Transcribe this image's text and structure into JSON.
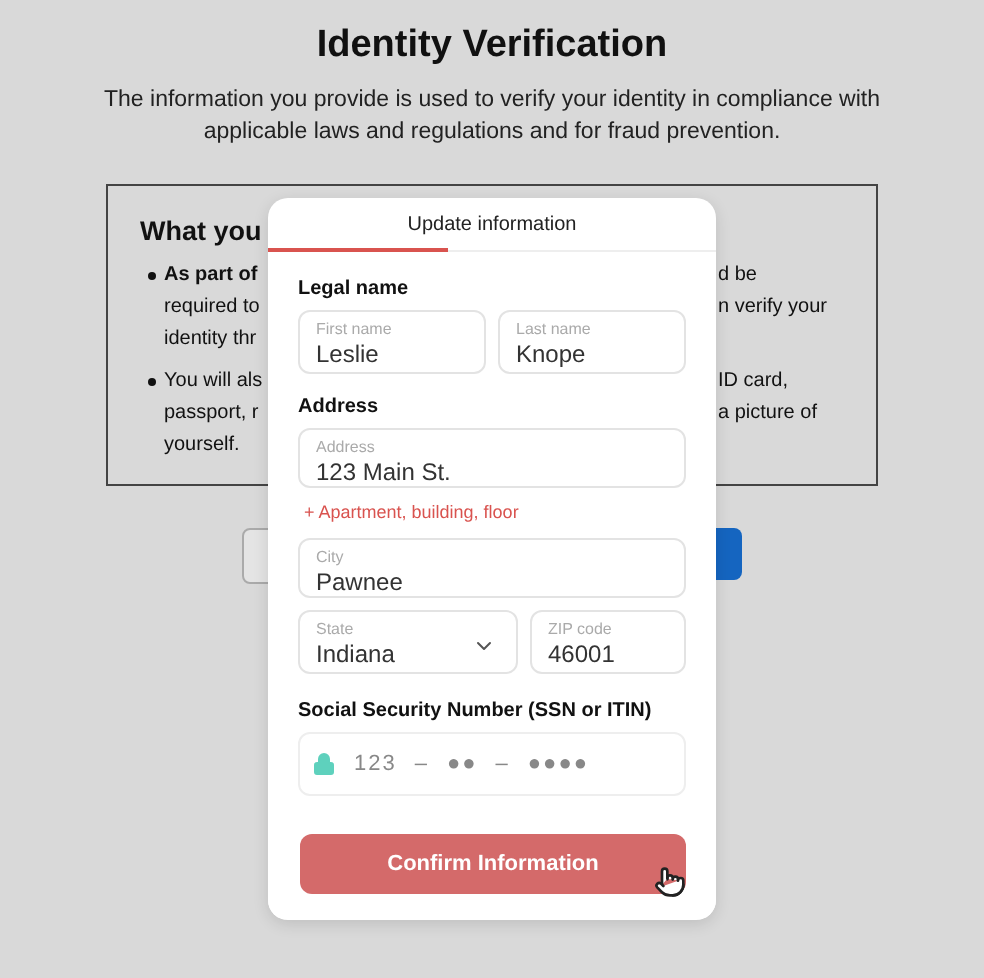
{
  "page": {
    "title": "Identity Verification",
    "subtitle": "The information you provide is used to verify your identity in compliance with applicable laws and regulations and for fraud prevention.",
    "box": {
      "heading": "What you",
      "bullets": [
        {
          "left": [
            "As part of",
            "required to",
            "identity thr"
          ],
          "right": [
            "d be",
            "n verify your"
          ]
        },
        {
          "left": [
            "You will als",
            "passport, r",
            "yourself."
          ],
          "right": [
            "ID card,",
            "a picture of"
          ]
        }
      ]
    }
  },
  "modal": {
    "tabs": [
      {
        "label": "Update information",
        "selected": true
      }
    ],
    "legal_name": {
      "label": "Legal name",
      "first": {
        "placeholder": "First name",
        "value": "Leslie"
      },
      "last": {
        "placeholder": "Last name",
        "value": "Knope"
      }
    },
    "address": {
      "label": "Address",
      "street": {
        "placeholder": "Address",
        "value": "123 Main St."
      },
      "add_line": "+ Apartment, building, floor",
      "city": {
        "placeholder": "City",
        "value": "Pawnee"
      },
      "state": {
        "placeholder": "State",
        "value": "Indiana"
      },
      "zip": {
        "placeholder": "ZIP code",
        "value": "46001"
      }
    },
    "ssn": {
      "label": "Social Security Number (SSN or ITIN)",
      "parts": [
        "123",
        "–",
        "●●",
        "–",
        "●●●●"
      ]
    },
    "confirm_button": "Confirm Information"
  }
}
